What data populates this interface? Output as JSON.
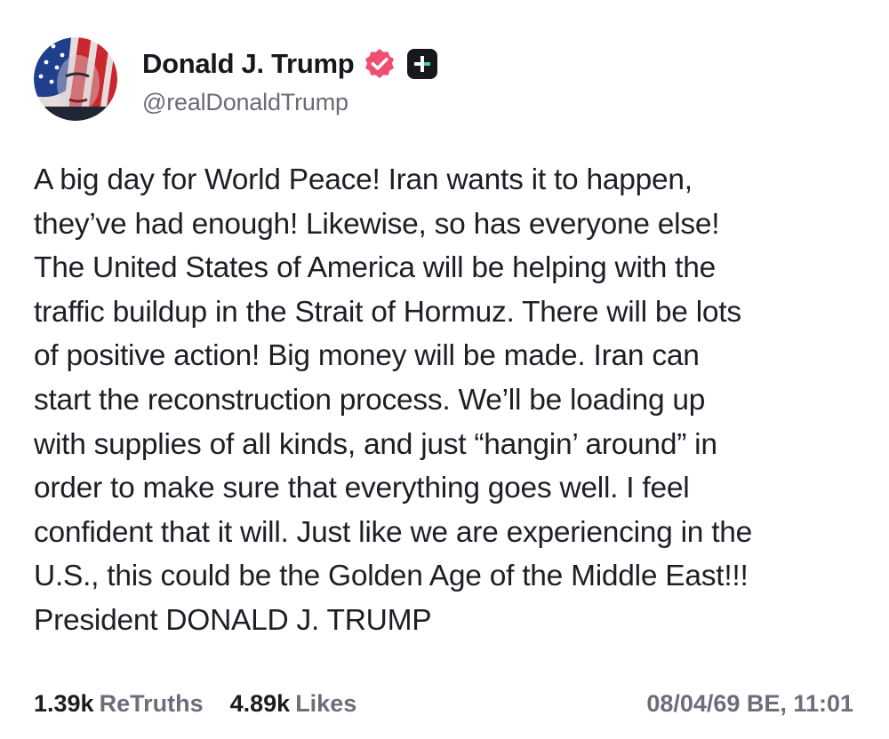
{
  "author": {
    "display_name": "Donald J. Trump",
    "handle": "@realDonaldTrump",
    "avatar_icon": "flag-portrait-avatar",
    "verified_icon": "verified-badge-icon",
    "verified_color": "#f04f6f",
    "plus_icon": "truth-plus-icon"
  },
  "post": {
    "lines": [
      "A big day for World Peace! Iran wants it to happen,",
      "they’ve had enough! Likewise, so has everyone else!",
      "The United States of America will be helping with the",
      "traffic buildup in the Strait of Hormuz. There will be lots",
      "of positive action! Big money will be made. Iran can",
      "start the reconstruction process. We’ll be loading up",
      "with supplies of all kinds, and just “hangin’ around” in",
      "order to make sure that everything goes well. I feel",
      "confident that it will. Just like we are experiencing in the",
      "U.S., this could be the Golden Age of the Middle East!!!",
      "President DONALD J. TRUMP"
    ]
  },
  "stats": {
    "retruths_count": "1.39k",
    "retruths_label": "ReTruths",
    "likes_count": "4.89k",
    "likes_label": "Likes",
    "timestamp": "08/04/69 BE, 11:01"
  }
}
